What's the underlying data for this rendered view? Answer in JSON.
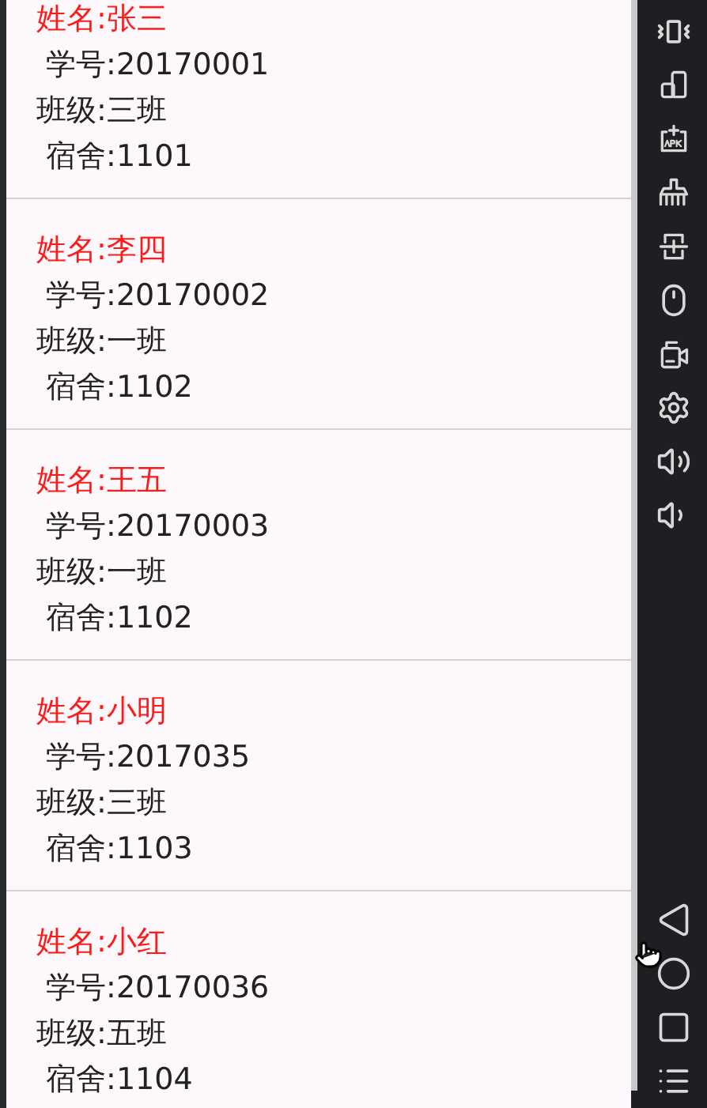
{
  "students": [
    {
      "name": "姓名:张三",
      "id": " 学号:20170001",
      "class": "班级:三班",
      "dorm": " 宿舍:1101"
    },
    {
      "name": "姓名:李四",
      "id": " 学号:20170002",
      "class": "班级:一班",
      "dorm": " 宿舍:1102"
    },
    {
      "name": "姓名:王五",
      "id": " 学号:20170003",
      "class": "班级:一班",
      "dorm": " 宿舍:1102"
    },
    {
      "name": "姓名:小明",
      "id": " 学号:2017035",
      "class": "班级:三班",
      "dorm": " 宿舍:1103"
    },
    {
      "name": "姓名:小红",
      "id": " 学号:20170036",
      "class": "班级:五班",
      "dorm": " 宿舍:1104"
    }
  ]
}
